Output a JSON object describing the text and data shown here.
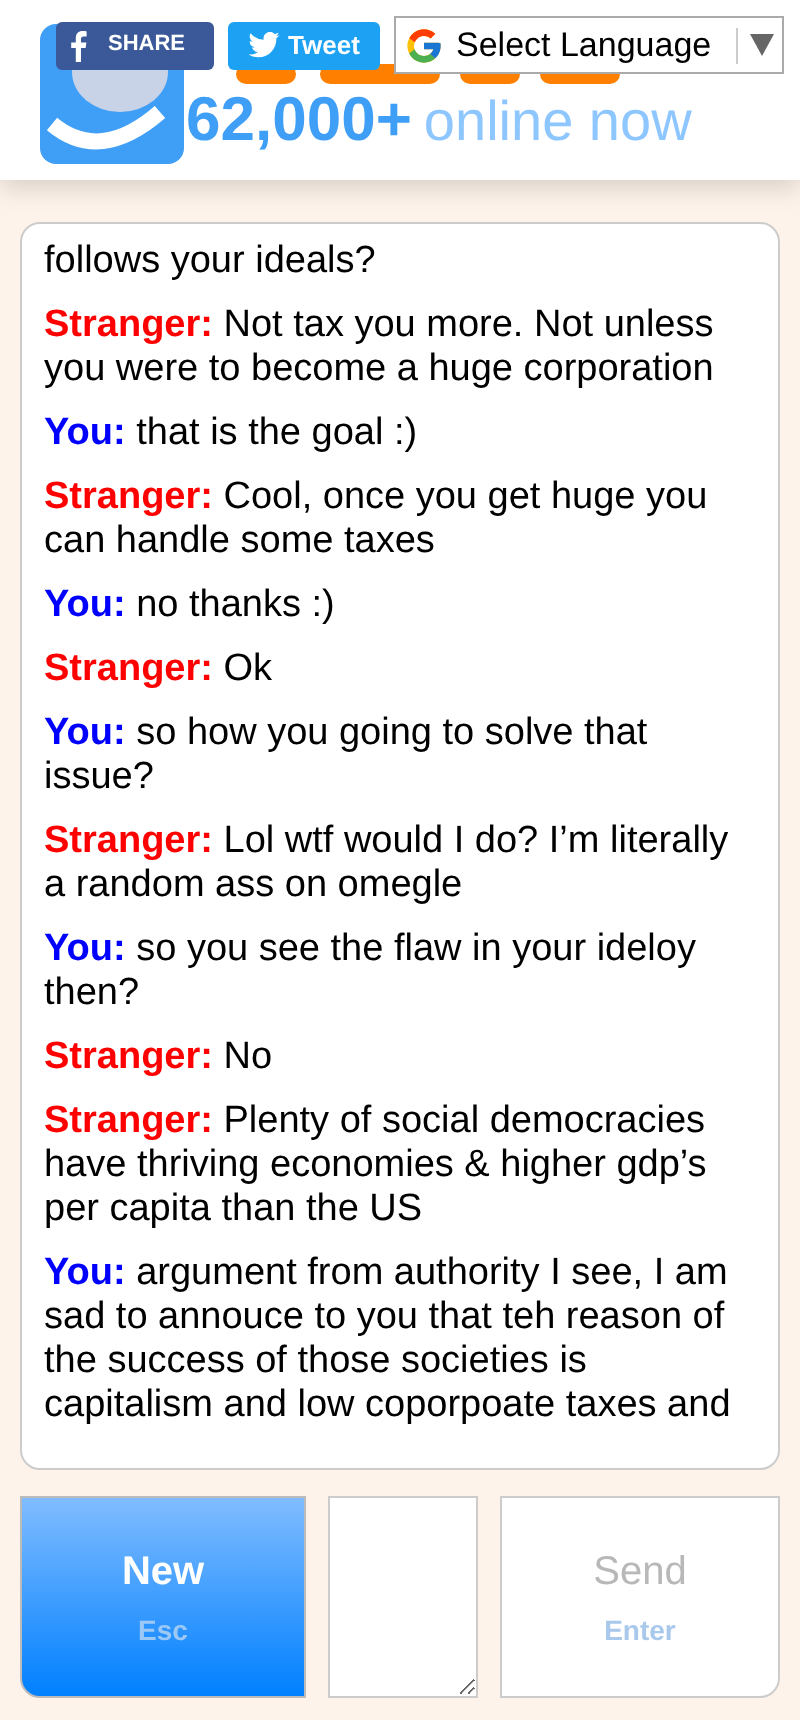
{
  "header": {
    "share_button": "SHARE",
    "tweet_button": "Tweet",
    "language_select": "Select Language",
    "online_count": "62,000+",
    "online_label": "online now"
  },
  "messages": [
    {
      "kind": "plain",
      "text": "follows your ideals?"
    },
    {
      "kind": "stranger",
      "label": "Stranger:",
      "text": "Not tax you more. Not unless you were to become a huge corporation"
    },
    {
      "kind": "you",
      "label": "You:",
      "text": "that is the goal :)"
    },
    {
      "kind": "stranger",
      "label": "Stranger:",
      "text": "Cool, once you get huge you can handle some taxes"
    },
    {
      "kind": "you",
      "label": "You:",
      "text": "no thanks :)"
    },
    {
      "kind": "stranger",
      "label": "Stranger:",
      "text": "Ok"
    },
    {
      "kind": "you",
      "label": "You:",
      "text": "so how you going to solve that issue?"
    },
    {
      "kind": "stranger",
      "label": "Stranger:",
      "text": "Lol wtf would I do? I’m literally a random ass on omegle"
    },
    {
      "kind": "you",
      "label": "You:",
      "text": "so you see the flaw in your ideloy then?"
    },
    {
      "kind": "stranger",
      "label": "Stranger:",
      "text": "No"
    },
    {
      "kind": "stranger",
      "label": "Stranger:",
      "text": "Plenty of social democracies have thriving economies & higher gdp’s per capita than the US"
    },
    {
      "kind": "you",
      "label": "You:",
      "text": "argument from authority I see, I am sad to annouce to you that teh reason of the success of those societies is capitalism and low coporpoate taxes and"
    }
  ],
  "controls": {
    "new_button": {
      "label": "New",
      "hint": "Esc"
    },
    "send_button": {
      "label": "Send",
      "hint": "Enter",
      "disabled": true
    }
  }
}
